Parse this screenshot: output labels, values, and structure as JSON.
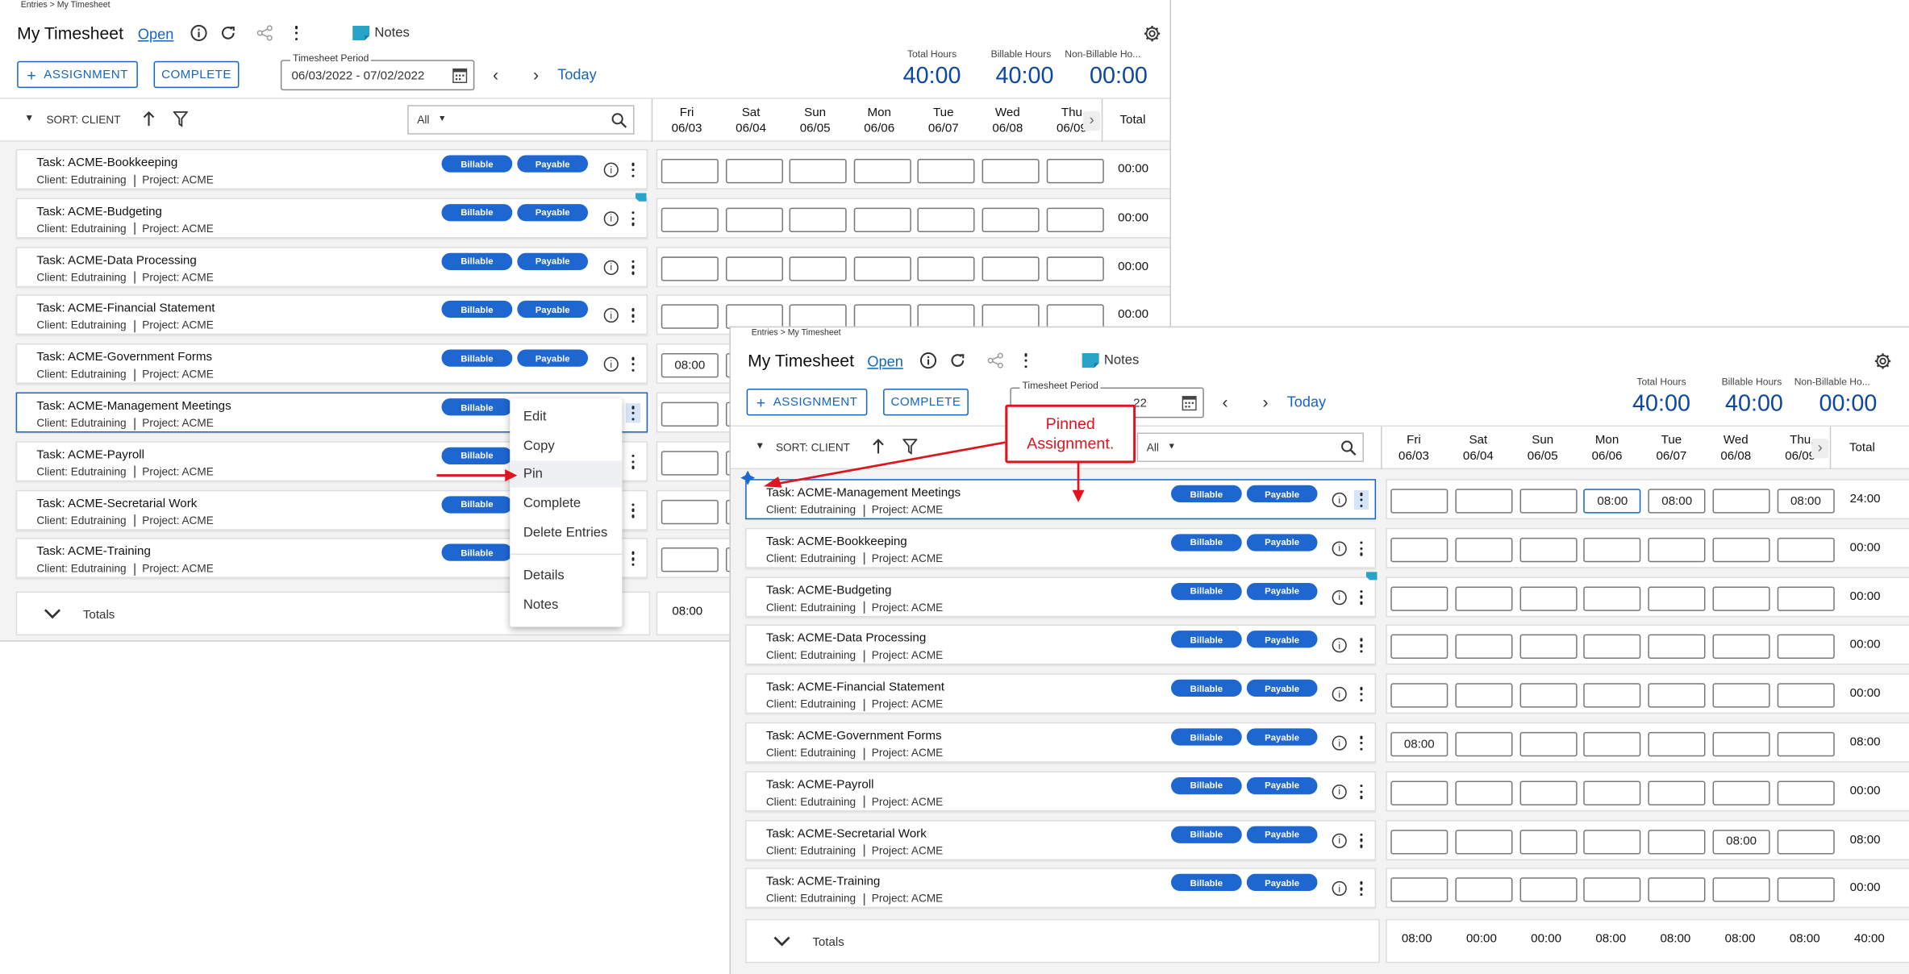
{
  "breadcrumb": "Entries > My Timesheet",
  "title": "My Timesheet",
  "status": "Open",
  "notes_label": "Notes",
  "buttons": {
    "assignment": "ASSIGNMENT",
    "complete": "COMPLETE"
  },
  "period": {
    "label": "Timesheet Period",
    "value": "06/03/2022 - 07/02/2022",
    "value_partial": "22"
  },
  "today": "Today",
  "summary": {
    "total_label": "Total Hours",
    "total_value": "40:00",
    "billable_label": "Billable Hours",
    "billable_value": "40:00",
    "nonbillable_label": "Non-Billable Ho...",
    "nonbillable_value": "00:00"
  },
  "sort_label": "SORT: CLIENT",
  "filter_value": "All",
  "days": [
    {
      "d": "Fri",
      "date": "06/03"
    },
    {
      "d": "Sat",
      "date": "06/04"
    },
    {
      "d": "Sun",
      "date": "06/05"
    },
    {
      "d": "Mon",
      "date": "06/06"
    },
    {
      "d": "Tue",
      "date": "06/07"
    },
    {
      "d": "Wed",
      "date": "06/08"
    },
    {
      "d": "Thu",
      "date": "06/09"
    }
  ],
  "total_header": "Total",
  "tags": {
    "billable": "Billable",
    "payable": "Payable"
  },
  "panel_a": {
    "rows": [
      {
        "task": "Task: ACME-Bookkeeping",
        "client": "Client: Edutraining",
        "project": "Project: ACME",
        "cells": [
          "",
          "",
          "",
          "",
          "",
          "",
          ""
        ],
        "total": "00:00"
      },
      {
        "task": "Task: ACME-Budgeting",
        "client": "Client: Edutraining",
        "project": "Project: ACME",
        "cells": [
          "",
          "",
          "",
          "",
          "",
          "",
          ""
        ],
        "total": "00:00"
      },
      {
        "task": "Task: ACME-Data Processing",
        "client": "Client: Edutraining",
        "project": "Project: ACME",
        "cells": [
          "",
          "",
          "",
          "",
          "",
          "",
          ""
        ],
        "total": "00:00"
      },
      {
        "task": "Task: ACME-Financial Statement",
        "client": "Client: Edutraining",
        "project": "Project: ACME",
        "cells": [
          "",
          "",
          "",
          "",
          "",
          "",
          ""
        ],
        "total": "00:00"
      },
      {
        "task": "Task: ACME-Government Forms",
        "client": "Client: Edutraining",
        "project": "Project: ACME",
        "cells": [
          "08:00",
          "",
          "",
          "",
          "",
          "",
          ""
        ],
        "total": ""
      },
      {
        "task": "Task: ACME-Management Meetings",
        "client": "Client: Edutraining",
        "project": "Project: ACME",
        "cells": [
          "",
          "",
          "",
          "",
          "",
          "",
          ""
        ],
        "total": ""
      },
      {
        "task": "Task: ACME-Payroll",
        "client": "Client: Edutraining",
        "project": "Project: ACME",
        "cells": [
          "",
          "",
          "",
          "",
          "",
          "",
          ""
        ],
        "total": ""
      },
      {
        "task": "Task: ACME-Secretarial Work",
        "client": "Client: Edutraining",
        "project": "Project: ACME",
        "cells": [
          "",
          "",
          "",
          "",
          "",
          "",
          ""
        ],
        "total": ""
      },
      {
        "task": "Task: ACME-Training",
        "client": "Client: Edutraining",
        "project": "Project: ACME",
        "cells": [
          "",
          "",
          "",
          "",
          "",
          "",
          ""
        ],
        "total": ""
      }
    ],
    "totals_label": "Totals",
    "totals": [
      "08:00"
    ]
  },
  "context_menu": [
    "Edit",
    "Copy",
    "Pin",
    "Complete",
    "Delete Entries",
    "Details",
    "Notes"
  ],
  "panel_b": {
    "rows": [
      {
        "task": "Task: ACME-Management Meetings",
        "client": "Client: Edutraining",
        "project": "Project: ACME",
        "cells": [
          "",
          "",
          "",
          "08:00",
          "08:00",
          "",
          "08:00"
        ],
        "total": "24:00"
      },
      {
        "task": "Task: ACME-Bookkeeping",
        "client": "Client: Edutraining",
        "project": "Project: ACME",
        "cells": [
          "",
          "",
          "",
          "",
          "",
          "",
          ""
        ],
        "total": "00:00"
      },
      {
        "task": "Task: ACME-Budgeting",
        "client": "Client: Edutraining",
        "project": "Project: ACME",
        "cells": [
          "",
          "",
          "",
          "",
          "",
          "",
          ""
        ],
        "total": "00:00"
      },
      {
        "task": "Task: ACME-Data Processing",
        "client": "Client: Edutraining",
        "project": "Project: ACME",
        "cells": [
          "",
          "",
          "",
          "",
          "",
          "",
          ""
        ],
        "total": "00:00"
      },
      {
        "task": "Task: ACME-Financial Statement",
        "client": "Client: Edutraining",
        "project": "Project: ACME",
        "cells": [
          "",
          "",
          "",
          "",
          "",
          "",
          ""
        ],
        "total": "00:00"
      },
      {
        "task": "Task: ACME-Government Forms",
        "client": "Client: Edutraining",
        "project": "Project: ACME",
        "cells": [
          "08:00",
          "",
          "",
          "",
          "",
          "",
          ""
        ],
        "total": "08:00"
      },
      {
        "task": "Task: ACME-Payroll",
        "client": "Client: Edutraining",
        "project": "Project: ACME",
        "cells": [
          "",
          "",
          "",
          "",
          "",
          "",
          ""
        ],
        "total": "00:00"
      },
      {
        "task": "Task: ACME-Secretarial Work",
        "client": "Client: Edutraining",
        "project": "Project: ACME",
        "cells": [
          "",
          "",
          "",
          "",
          "",
          "08:00",
          ""
        ],
        "total": "08:00"
      },
      {
        "task": "Task: ACME-Training",
        "client": "Client: Edutraining",
        "project": "Project: ACME",
        "cells": [
          "",
          "",
          "",
          "",
          "",
          "",
          ""
        ],
        "total": "00:00"
      }
    ],
    "totals_label": "Totals",
    "totals": [
      "08:00",
      "00:00",
      "00:00",
      "08:00",
      "08:00",
      "08:00",
      "08:00",
      "40:00"
    ]
  },
  "callout": "Pinned Assignment.",
  "colors": {
    "accent": "#1565c0",
    "tag": "#1e66d0",
    "annotation": "#e0141e",
    "note_flag": "#2aa3c9"
  }
}
